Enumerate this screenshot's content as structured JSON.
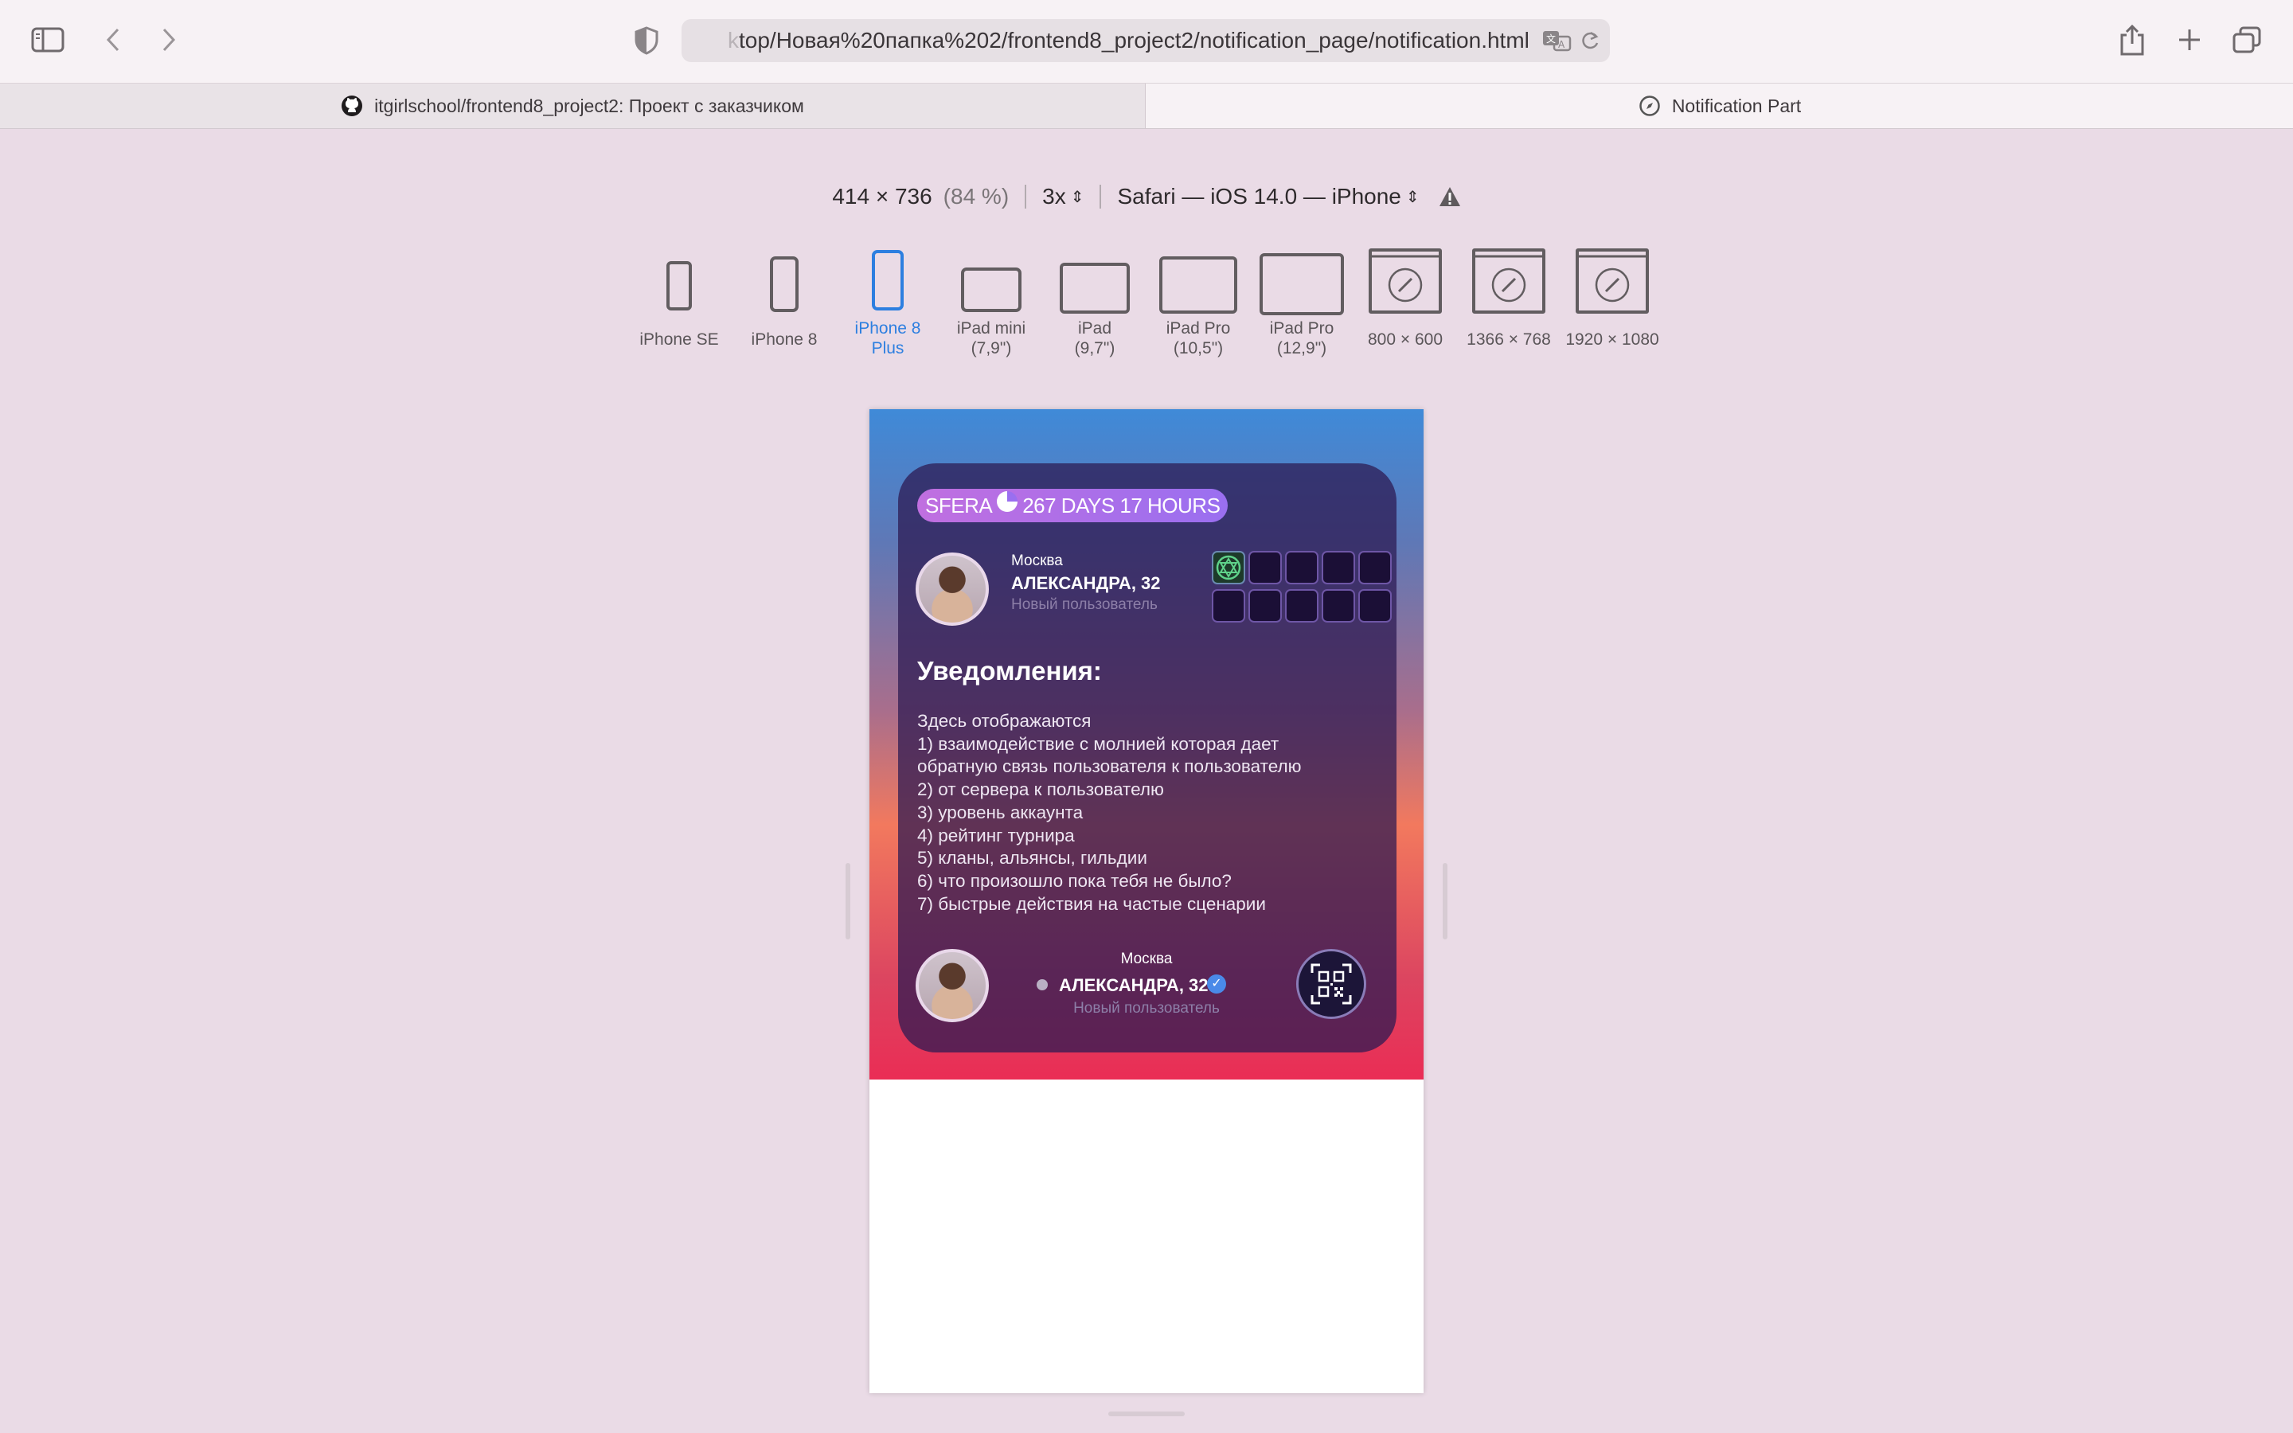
{
  "browser": {
    "address_prefix": "k",
    "address": "top/Новая%20папка%202/frontend8_project2/notification_page/notification.html",
    "tabs": [
      {
        "title": "itgirlschool/frontend8_project2: Проект с заказчиком",
        "icon": "github-icon"
      },
      {
        "title": "Notification Part",
        "icon": "compass-icon"
      }
    ]
  },
  "responsive": {
    "size": "414 × 736",
    "zoom": "(84 %)",
    "scale": "3x",
    "ua": "Safari — iOS 14.0 — iPhone",
    "devices": [
      {
        "label": "iPhone SE"
      },
      {
        "label": "iPhone 8"
      },
      {
        "label": "iPhone 8 Plus",
        "selected": true
      },
      {
        "label": "iPad mini (7,9\")"
      },
      {
        "label": "iPad (9,7\")"
      },
      {
        "label": "iPad Pro (10,5\")"
      },
      {
        "label": "iPad Pro (12,9\")"
      },
      {
        "label": "800 × 600"
      },
      {
        "label": "1366 × 768"
      },
      {
        "label": "1920 × 1080"
      }
    ]
  },
  "app": {
    "badge": {
      "brand": "SFERA",
      "timer": "267 DAYS 17 HOURS"
    },
    "profile": {
      "city": "Москва",
      "name": "АЛЕКСАНДРА, 32",
      "status": "Новый пользователь"
    },
    "notifications": {
      "title": "Уведомления:",
      "lines": [
        "Здесь отображаются",
        "1) взаимодействие с молнией которая дает",
        "обратную связь пользователя к пользователю",
        "2) от сервера к пользователю",
        "3) уровень аккаунта",
        "4) рейтинг турнира",
        "5) кланы, альянсы, гильдии",
        "6) что произошло пока тебя не было?",
        "7) быстрые действия на частые сценарии"
      ]
    },
    "footer_profile": {
      "city": "Москва",
      "name": "АЛЕКСАНДРА, 32",
      "status": "Новый пользователь"
    }
  },
  "colors": {
    "accent": "#2d7fe0",
    "badge": "#b06fe8",
    "card": "#2d1952"
  }
}
